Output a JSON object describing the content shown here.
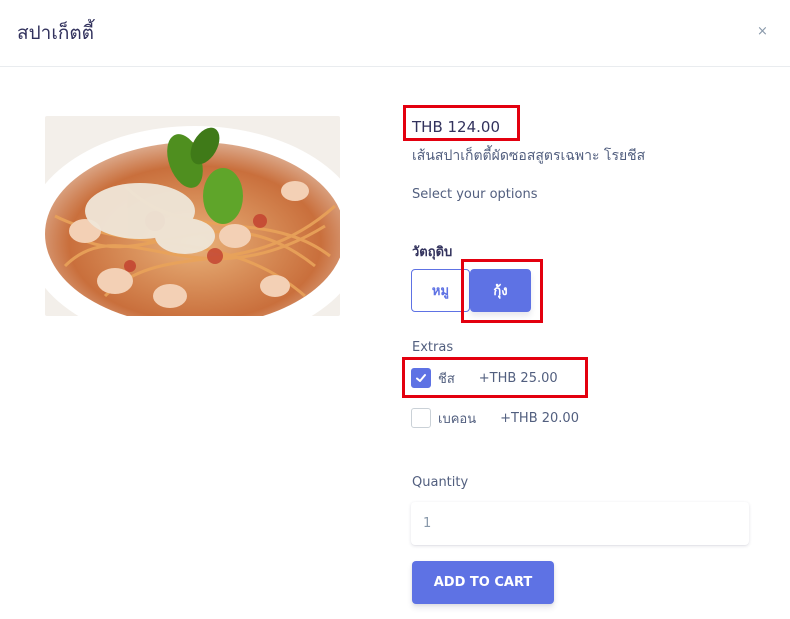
{
  "modal": {
    "title": "สปาเก็ตตี้",
    "close_symbol": "×"
  },
  "product": {
    "image_icon": "spaghetti-shrimp-photo",
    "price": "THB 124.00",
    "description": "เส้นสปาเก็ตตี้ผัดซอสสูตรเฉพาะ โรยชีส",
    "options_heading": "Select your options"
  },
  "ingredient": {
    "label": "วัตถุดิบ",
    "options": [
      {
        "label": "หมู",
        "selected": false
      },
      {
        "label": "กุ้ง",
        "selected": true
      }
    ]
  },
  "extras": {
    "label": "Extras",
    "items": [
      {
        "name": "ชีส",
        "price": "+THB 25.00",
        "checked": true
      },
      {
        "name": "เบคอน",
        "price": "+THB 20.00",
        "checked": false
      }
    ]
  },
  "quantity": {
    "label": "Quantity",
    "value": "1"
  },
  "cart": {
    "button_label": "ADD TO CART"
  },
  "colors": {
    "primary": "#5e72e4",
    "highlight_box": "#e3000f"
  }
}
